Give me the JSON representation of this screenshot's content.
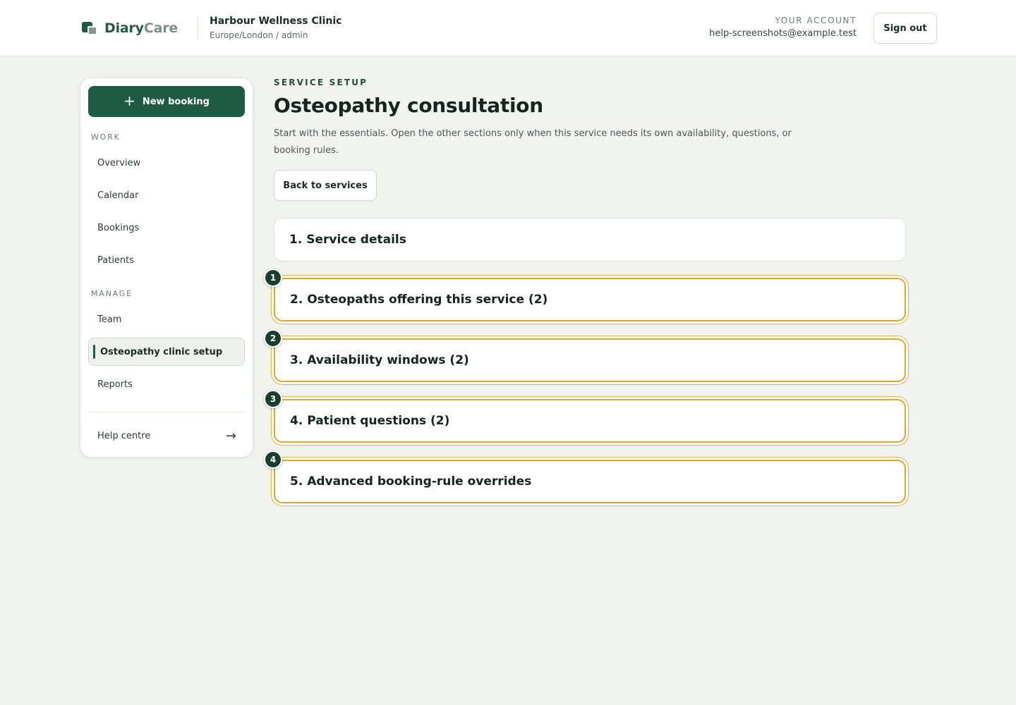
{
  "header": {
    "brand_part1": "Diary",
    "brand_part2": "Care",
    "clinic_name": "Harbour Wellness Clinic",
    "clinic_sub": "Europe/London / admin",
    "account_label": "YOUR ACCOUNT",
    "account_email": "help-screenshots@example.test",
    "signout_label": "Sign out"
  },
  "sidebar": {
    "new_booking_label": "New booking",
    "work_label": "WORK",
    "work_items": [
      {
        "label": "Overview"
      },
      {
        "label": "Calendar"
      },
      {
        "label": "Bookings"
      },
      {
        "label": "Patients"
      }
    ],
    "manage_label": "MANAGE",
    "manage_items": [
      {
        "label": "Team"
      },
      {
        "label": "Osteopathy clinic setup",
        "active": true
      },
      {
        "label": "Reports"
      }
    ],
    "help_label": "Help centre"
  },
  "main": {
    "eyebrow": "SERVICE SETUP",
    "title": "Osteopathy consultation",
    "intro": "Start with the essentials. Open the other sections only when this service needs its own availability, questions, or booking rules.",
    "back_label": "Back to services",
    "sections": [
      {
        "label": "1. Service details"
      },
      {
        "label": "2. Osteopaths offering this service (2)",
        "badge": "1"
      },
      {
        "label": "3. Availability windows (2)",
        "badge": "2"
      },
      {
        "label": "4. Patient questions (2)",
        "badge": "3"
      },
      {
        "label": "5. Advanced booking-rule overrides",
        "badge": "4"
      }
    ]
  },
  "colors": {
    "brand": "#1f5a44",
    "highlight": "#e8a520",
    "badge": "#1b3d30"
  }
}
